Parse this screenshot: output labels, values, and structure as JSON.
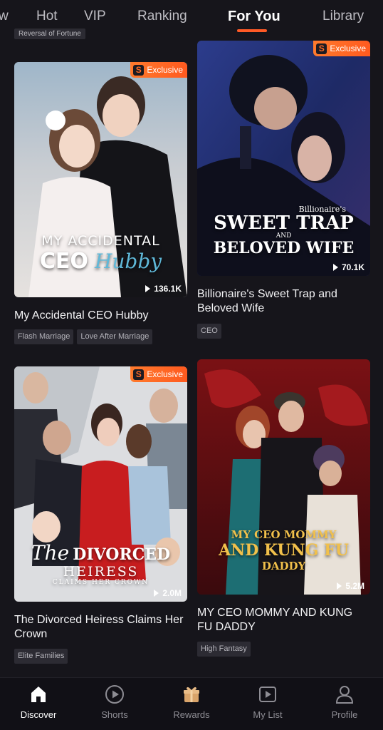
{
  "top_tabs": [
    {
      "label": "w"
    },
    {
      "label": "Hot"
    },
    {
      "label": "VIP"
    },
    {
      "label": "Ranking"
    },
    {
      "label": "For You",
      "active": true
    },
    {
      "label": "Library"
    }
  ],
  "partial_tag": "Reversal of Fortune",
  "exclusive_label": "Exclusive",
  "logo_letter": "S",
  "cards": [
    {
      "title": "My Accidental CEO Hubby",
      "views": "136.1K",
      "exclusive": true,
      "tags": [
        "Flash Marriage",
        "Love After Marriage"
      ],
      "poster_lines": [
        "MY ACCIDENTAL",
        "CEO",
        "Hubby"
      ]
    },
    {
      "title": "Billionaire's Sweet Trap and Beloved Wife",
      "views": "70.1K",
      "exclusive": true,
      "tags": [
        "CEO"
      ],
      "poster_lines": [
        "Billionaire's",
        "SWEET TRAP",
        "AND",
        "BELOVED WIFE"
      ]
    },
    {
      "title": "The Divorced Heiress Claims Her Crown",
      "views": "2.0M",
      "exclusive": true,
      "tags": [
        "Elite Families"
      ],
      "poster_lines": [
        "The",
        "DIVORCED",
        "HEIRESS",
        "CLAIMS HER CROWN"
      ]
    },
    {
      "title": "MY CEO MOMMY AND KUNG FU DADDY",
      "views": "5.2M",
      "exclusive": false,
      "tags": [
        "High Fantasy"
      ],
      "poster_lines": [
        "MY CEO MOMMY",
        "AND KUNG FU",
        "DADDY"
      ]
    }
  ],
  "bottom_nav": [
    {
      "label": "Discover",
      "icon": "home-icon",
      "active": true
    },
    {
      "label": "Shorts",
      "icon": "play-circle-icon"
    },
    {
      "label": "Rewards",
      "icon": "gift-icon"
    },
    {
      "label": "My List",
      "icon": "play-square-icon"
    },
    {
      "label": "Profile",
      "icon": "person-icon"
    }
  ],
  "colors": {
    "accent": "#ff5a26",
    "background": "#16151b",
    "tag_bg": "#2c2b33"
  }
}
